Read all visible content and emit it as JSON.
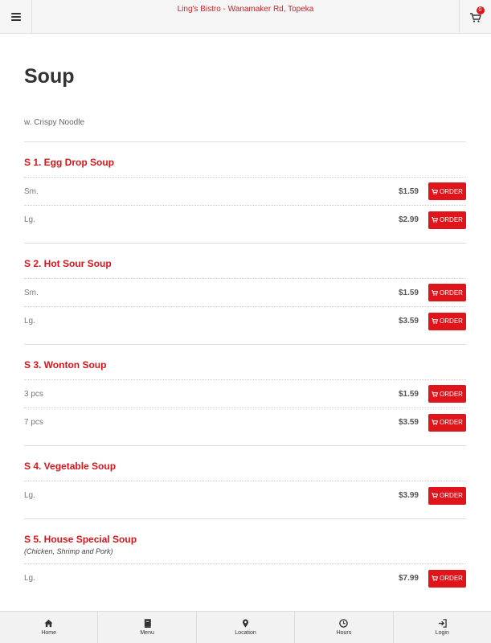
{
  "header": {
    "restaurant_name": "Ling's Bistro - Wanamaker Rd, Topeka",
    "cart_count": "0",
    "menu_icon": "hamburger-icon",
    "cart_icon": "cart-icon"
  },
  "page": {
    "title": "Soup",
    "subtitle": "w. Crispy Noodle"
  },
  "order_label": "ORDER",
  "colors": {
    "accent": "#e0151b",
    "item_name": "#d9151b",
    "header_bg": "#f5f5f5"
  },
  "items": [
    {
      "name": "S 1. Egg Drop Soup",
      "options": [
        {
          "size": "Sm.",
          "price": "$1.59"
        },
        {
          "size": "Lg.",
          "price": "$2.99"
        }
      ]
    },
    {
      "name": "S 2. Hot Sour Soup",
      "options": [
        {
          "size": "Sm.",
          "price": "$1.59"
        },
        {
          "size": "Lg.",
          "price": "$3.59"
        }
      ]
    },
    {
      "name": "S 3. Wonton Soup",
      "options": [
        {
          "size": "3 pcs",
          "price": "$1.59"
        },
        {
          "size": "7 pcs",
          "price": "$3.59"
        }
      ]
    },
    {
      "name": "S 4. Vegetable Soup",
      "options": [
        {
          "size": "Lg.",
          "price": "$3.99"
        }
      ]
    },
    {
      "name": "S 5. House Special Soup",
      "description": "(Chicken, Shrimp and Pork)",
      "options": [
        {
          "size": "Lg.",
          "price": "$7.99"
        }
      ]
    }
  ],
  "bottom_nav": [
    {
      "label": "Home",
      "icon": "home-icon"
    },
    {
      "label": "Menu",
      "icon": "book-icon"
    },
    {
      "label": "Location",
      "icon": "map-marker-icon"
    },
    {
      "label": "Hours",
      "icon": "clock-icon"
    },
    {
      "label": "Login",
      "icon": "login-icon"
    }
  ]
}
